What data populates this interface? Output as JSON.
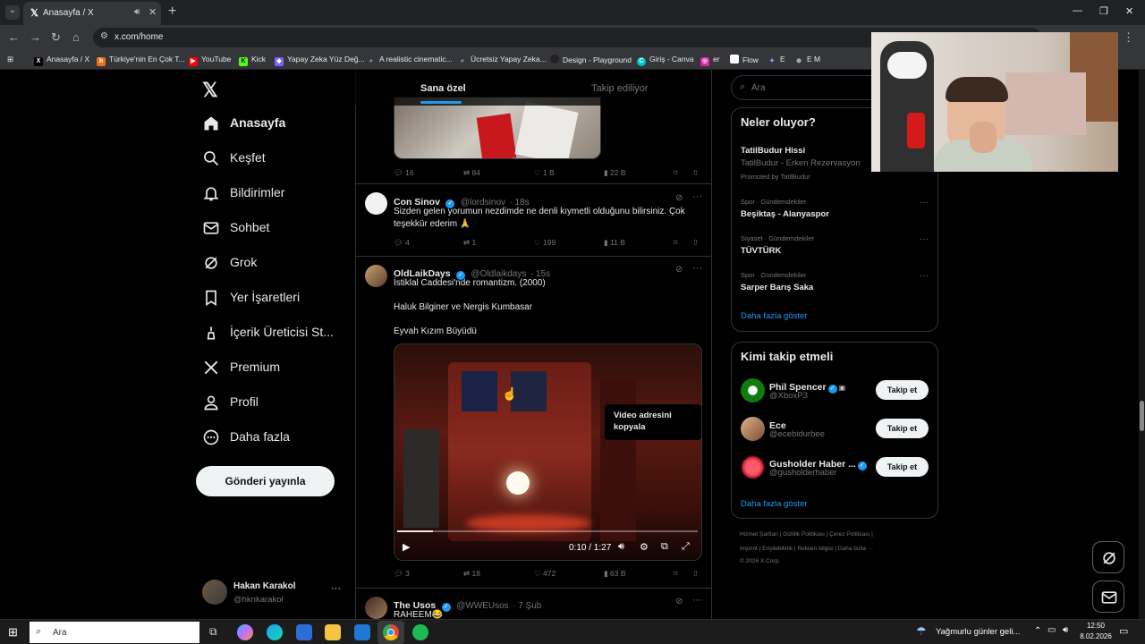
{
  "browser": {
    "tab_title": "Anasayfa / X",
    "url": "x.com/home",
    "bookmarks": [
      "Anasayfa / X",
      "Türkiye'nin En Çok T...",
      "YouTube",
      "Kick",
      "Yapay Zeka Yüz Değ...",
      "A realistic cinematic...",
      "Ücretsiz Yapay Zeka...",
      "Design - Playground",
      "Giriş - Canva",
      "er",
      "Flow",
      "E",
      "E M"
    ]
  },
  "sidebar": {
    "items": [
      {
        "label": "Anasayfa",
        "icon": "home-icon"
      },
      {
        "label": "Keşfet",
        "icon": "search-icon"
      },
      {
        "label": "Bildirimler",
        "icon": "bell-icon"
      },
      {
        "label": "Sohbet",
        "icon": "mail-icon"
      },
      {
        "label": "Grok",
        "icon": "grok-icon"
      },
      {
        "label": "Yer İşaretleri",
        "icon": "bookmark-icon"
      },
      {
        "label": "İçerik Üreticisi St...",
        "icon": "creator-icon"
      },
      {
        "label": "Premium",
        "icon": "x-icon"
      },
      {
        "label": "Profil",
        "icon": "person-icon"
      },
      {
        "label": "Daha fazla",
        "icon": "more-circle-icon"
      }
    ],
    "post_button": "Gönderi yayınla",
    "user_name": "Hakan Karakol",
    "user_handle": "@hknkarakol",
    "user_more": "···"
  },
  "feed": {
    "tabs": [
      "Sana özel",
      "Takip ediliyor"
    ],
    "top_actions": {
      "replies": "16",
      "reposts": "84",
      "likes": "1 B",
      "views": "22 B"
    },
    "tweets": [
      {
        "name": "Con Sinov",
        "handle": "@lordsinov",
        "time": "· 18s",
        "text": "Sizden gelen yorumun nezdimde ne denli kıymetli olduğunu bilirsiniz. Çok teşekkür ederim 🙏",
        "replies": "4",
        "reposts": "1",
        "likes": "199",
        "views": "11 B"
      },
      {
        "name": "OldLaikDays",
        "handle": "@Oldlaikdays",
        "time": "· 15s",
        "text1": "İstiklal Caddesi'nde romantizm. (2000)",
        "text2": "Haluk Bilginer ve Nergis Kumbasar",
        "text3": "Eyvah Kızım Büyüdü",
        "video_time": "0:10 / 1:27",
        "tooltip": "Video adresini kopyala",
        "replies": "3",
        "reposts": "18",
        "likes": "472",
        "views": "63 B"
      },
      {
        "name": "The Usos",
        "handle": "@WWEUsos",
        "time": "· 7 Şub",
        "text": "RAHEEM😂"
      }
    ]
  },
  "right": {
    "search_placeholder": "Ara",
    "trends_title": "Neler oluyor?",
    "promo_title": "TatilBudur Hissi",
    "promo_sub": "TatilBudur - Erken Rezervasyon",
    "promo_by": "Promoted by TatilBudur",
    "trends": [
      {
        "meta": "Spor · Gündemdekiler",
        "label": "Beşiktaş - Alanyaspor"
      },
      {
        "meta": "Siyaset · Gündemdekiler",
        "label": "TÜVTÜRK"
      },
      {
        "meta": "Spor · Gündemdekiler",
        "label": "Sarper Barış Saka"
      }
    ],
    "show_more": "Daha fazla göster",
    "who_title": "Kimi takip etmeli",
    "who": [
      {
        "name": "Phil Spencer",
        "handle": "@XboxP3",
        "btn": "Takip et"
      },
      {
        "name": "Ece",
        "handle": "@ecebidurbee",
        "btn": "Takip et"
      },
      {
        "name": "Gusholder Haber ...",
        "handle": "@gusholderhaber",
        "btn": "Takip et"
      }
    ],
    "who_more": "Daha fazla göster",
    "footer1": "Hizmet Şartları  |  Gizlilik Politikası  |  Çerez Politikası  |",
    "footer2": "Imprint  |  Erişilebilirlik  |  Reklam bilgisi  |  Daha fazla ···",
    "footer3": "© 2026 X Corp."
  },
  "taskbar": {
    "search": "Ara",
    "weather": "Yağmurlu günler geli...",
    "time": "12:50",
    "date": "8.02.2026"
  }
}
